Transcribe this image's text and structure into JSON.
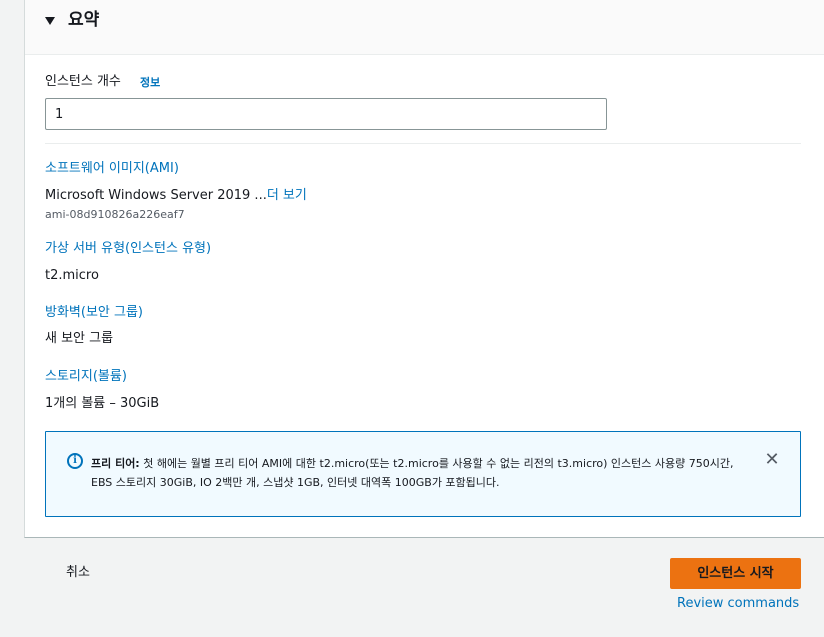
{
  "summary": {
    "title": "요약"
  },
  "instance_count": {
    "label": "인스턴스 개수",
    "info_link": "정보",
    "value": "1"
  },
  "ami": {
    "title": "소프트웨어 이미지(AMI)",
    "name": "Microsoft Windows Server 2019 ...",
    "more_link": "더 보기",
    "id": "ami-08d910826a226eaf7"
  },
  "instance_type": {
    "title": "가상 서버 유형(인스턴스 유형)",
    "value": "t2.micro"
  },
  "firewall": {
    "title": "방화벽(보안 그룹)",
    "value": "새 보안 그룹"
  },
  "storage": {
    "title": "스토리지(볼륨)",
    "value": "1개의 볼륨 – 30GiB"
  },
  "free_tier_alert": {
    "icon": "info-icon",
    "heading": "프리 티어:",
    "message": " 첫 해에는 월별 프리 티어 AMI에 대한 t2.micro(또는 t2.micro를 사용할 수 없는 리전의 t3.micro) 인스턴스 사용량 750시간, EBS 스토리지 30GiB, IO 2백만 개, 스냅샷 1GB, 인터넷 대역폭 100GB가 포함됩니다.",
    "close_icon": "close-icon"
  },
  "footer": {
    "cancel_label": "취소",
    "launch_label": "인스턴스 시작",
    "review_label": "Review commands"
  },
  "colors": {
    "link": "#0073bb",
    "primary_button": "#ec7211",
    "alert_bg": "#f1faff",
    "page_bg": "#f2f3f3"
  }
}
